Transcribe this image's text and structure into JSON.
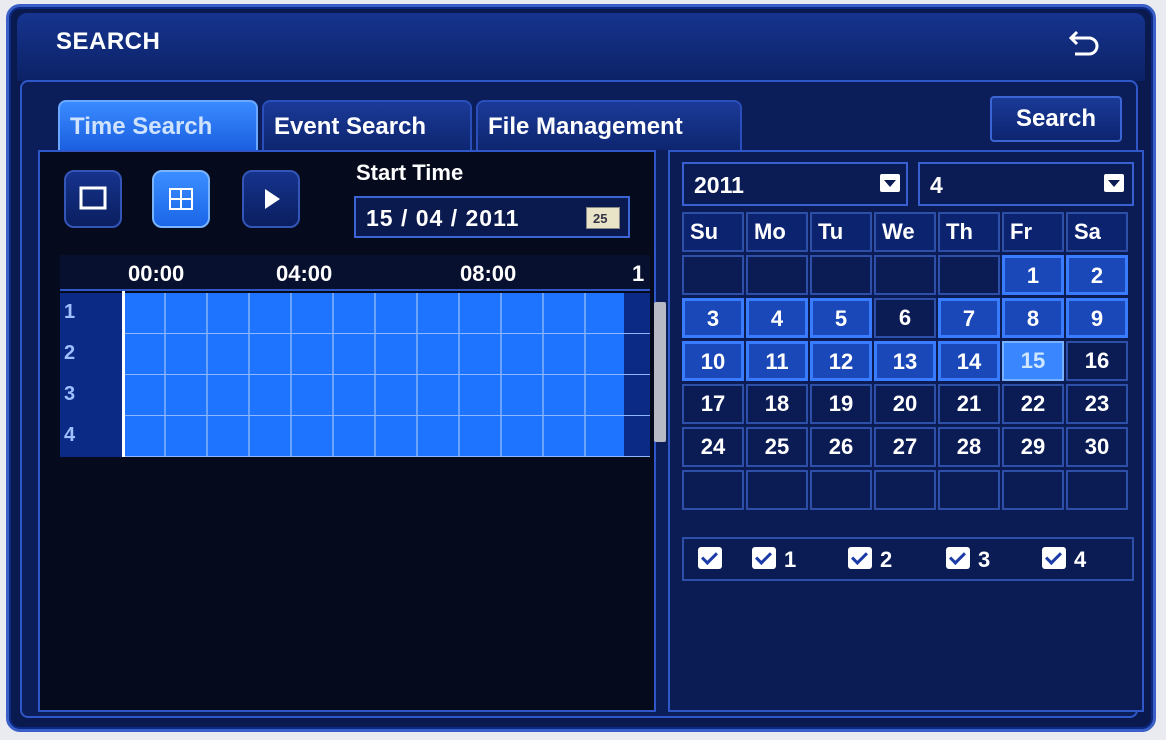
{
  "window": {
    "title": "SEARCH",
    "back_icon": "return-arrow-icon"
  },
  "tabs": [
    {
      "label": "Time Search",
      "active": true
    },
    {
      "label": "Event Search",
      "active": false
    },
    {
      "label": "File Management",
      "active": false
    }
  ],
  "search_button": "Search",
  "view_modes": [
    {
      "icon": "single-view-icon",
      "active": false
    },
    {
      "icon": "quad-view-icon",
      "active": true
    },
    {
      "icon": "play-icon",
      "active": false
    }
  ],
  "start_time": {
    "label": "Start Time",
    "value": "15 / 04 / 2011",
    "calendar_icon_text": "25"
  },
  "timeline": {
    "times": [
      "00:00",
      "04:00",
      "08:00",
      "1"
    ],
    "channels": [
      "1",
      "2",
      "3",
      "4"
    ]
  },
  "calendar": {
    "year": "2011",
    "month": "4",
    "weekdays": [
      "Su",
      "Mo",
      "Tu",
      "We",
      "Th",
      "Fr",
      "Sa"
    ],
    "weeks": [
      [
        "",
        "",
        "",
        "",
        "",
        "1",
        "2"
      ],
      [
        "3",
        "4",
        "5",
        "6",
        "7",
        "8",
        "9"
      ],
      [
        "10",
        "11",
        "12",
        "13",
        "14",
        "15",
        "16"
      ],
      [
        "17",
        "18",
        "19",
        "20",
        "21",
        "22",
        "23"
      ],
      [
        "24",
        "25",
        "26",
        "27",
        "28",
        "29",
        "30"
      ],
      [
        "",
        "",
        "",
        "",
        "",
        "",
        ""
      ]
    ],
    "days_with_records": [
      "1",
      "2",
      "3",
      "4",
      "5",
      "7",
      "8",
      "9",
      "10",
      "11",
      "12",
      "13",
      "14"
    ],
    "selected_day": "15"
  },
  "channels": {
    "all_checked": true,
    "items": [
      {
        "label": "1",
        "checked": true
      },
      {
        "label": "2",
        "checked": true
      },
      {
        "label": "3",
        "checked": true
      },
      {
        "label": "4",
        "checked": true
      }
    ]
  },
  "colors": {
    "accent": "#1e74ff",
    "panel": "#0b1c55",
    "border": "#2f57c8"
  }
}
